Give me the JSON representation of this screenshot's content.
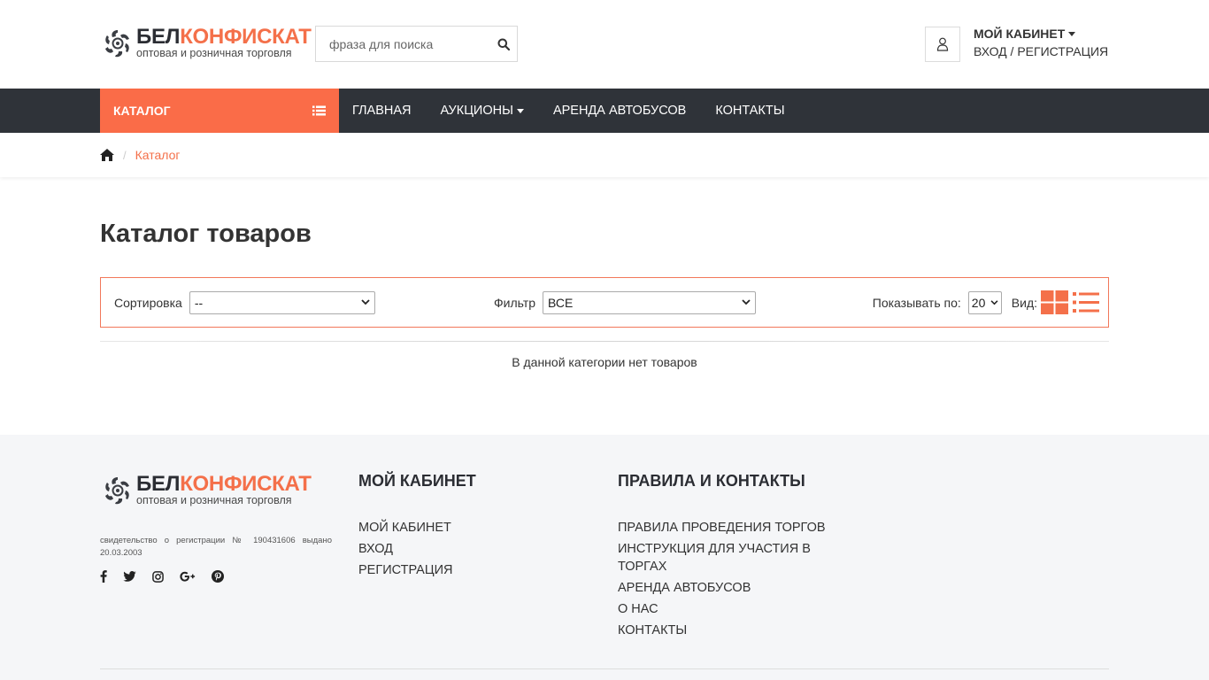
{
  "header": {
    "logo": {
      "part1": "БЕЛ",
      "part2": "КОНФИСКАТ",
      "tagline": "оптовая и розничная торговля"
    },
    "search": {
      "placeholder": "фраза для поиска"
    },
    "account": {
      "title": "МОЙ КАБИНЕТ",
      "links": "ВХОД / РЕГИСТРАЦИЯ"
    }
  },
  "nav": {
    "catalog": "КАТАЛОГ",
    "items": [
      {
        "label": "ГЛАВНАЯ"
      },
      {
        "label": "АУКЦИОНЫ"
      },
      {
        "label": "АРЕНДА АВТОБУСОВ"
      },
      {
        "label": "КОНТАКТЫ"
      }
    ]
  },
  "breadcrumb": {
    "sep": "/",
    "current": "Каталог"
  },
  "main": {
    "title": "Каталог товаров",
    "sort": {
      "label": "Сортировка",
      "value": "--"
    },
    "filter": {
      "label": "Фильтр",
      "value": "ВСЕ"
    },
    "perpage": {
      "label": "Показывать по:",
      "value": "20"
    },
    "view": {
      "label": "Вид:"
    },
    "empty": "В данной категории нет товаров"
  },
  "footer": {
    "registration": "свидетельство о регистрации № 190431606 выдано 20.03.2003",
    "col1": {
      "title": "МОЙ КАБИНЕТ",
      "links": [
        "МОЙ КАБИНЕТ",
        "ВХОД",
        "РЕГИСТРАЦИЯ"
      ]
    },
    "col2": {
      "title": "ПРАВИЛА И КОНТАКТЫ",
      "links": [
        "ПРАВИЛА ПРОВЕДЕНИЯ ТОРГОВ",
        "ИНСТРУКЦИЯ ДЛЯ УЧАСТИЯ В ТОРГАХ",
        "АРЕНДА АВТОБУСОВ",
        "О НАС",
        "КОНТАКТЫ"
      ]
    }
  },
  "colors": {
    "accent": "#fa6c48",
    "nav_bg": "#2f3339",
    "footer_bg": "#f5f6f8"
  }
}
